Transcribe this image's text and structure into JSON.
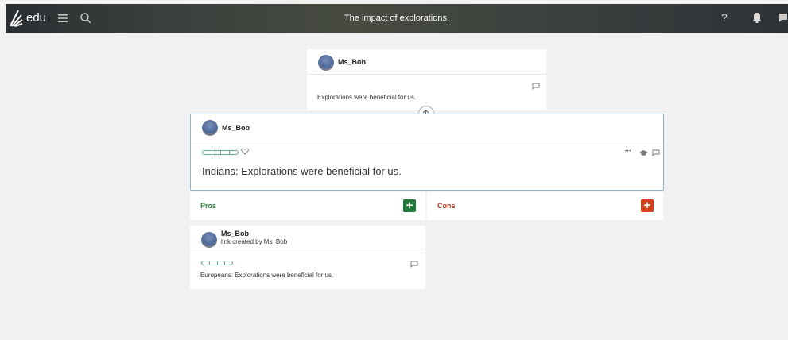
{
  "topbar": {
    "brand": "edu",
    "title": "The impact of explorations.",
    "help_label": "?"
  },
  "parent_card": {
    "author": "Ms_Bob",
    "text": "Explorations were beneficial for us."
  },
  "main_card": {
    "author": "Ms_Bob",
    "text": "Indians: Explorations were beneficial for us.",
    "more_label": "•••"
  },
  "pros": {
    "label": "Pros",
    "add_label": "+",
    "color": "#2e7d3e",
    "button_color": "#1f7a3a"
  },
  "cons": {
    "label": "Cons",
    "add_label": "+",
    "color": "#c43a1f",
    "button_color": "#d2401d"
  },
  "child_card": {
    "author": "Ms_Bob",
    "subtitle": "link created by Ms_Bob",
    "text": "Europeans: Explorations were beneficial for us."
  },
  "icons": {
    "logo": "edu-logo-icon",
    "menu": "hamburger-menu-icon",
    "search": "search-icon",
    "help": "help-icon",
    "bell": "bell-icon",
    "flag": "flag-icon",
    "comment": "comment-icon",
    "heart": "heart-icon",
    "graduation": "graduation-cap-icon",
    "up_arrow": "up-arrow-icon"
  }
}
